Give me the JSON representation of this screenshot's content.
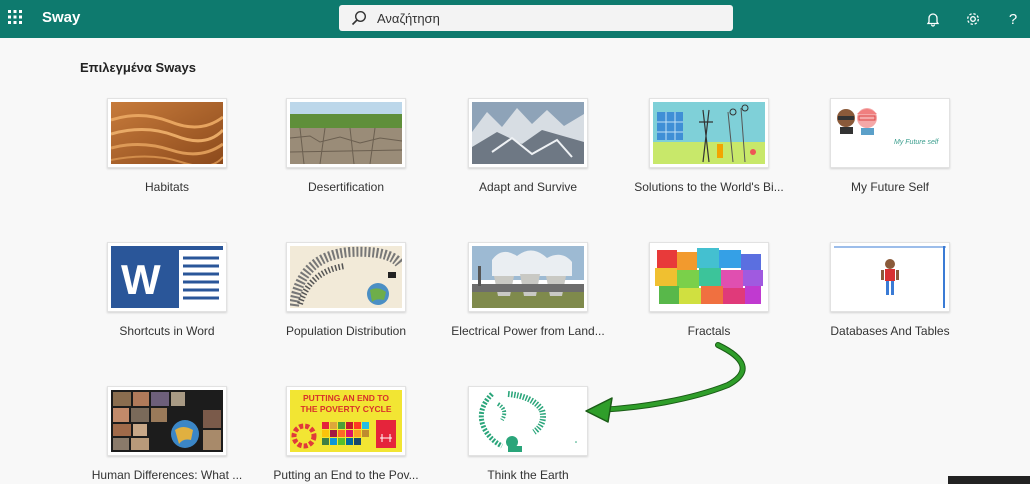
{
  "app": {
    "title": "Sway"
  },
  "search": {
    "placeholder": "Αναζήτηση"
  },
  "section": {
    "title": "Επιλεγμένα Sways"
  },
  "cards": [
    {
      "label": "Habitats"
    },
    {
      "label": "Desertification"
    },
    {
      "label": "Adapt and Survive"
    },
    {
      "label": "Solutions to the World's Bi..."
    },
    {
      "label": "My Future Self"
    },
    {
      "label": "Shortcuts in Word"
    },
    {
      "label": "Population Distribution"
    },
    {
      "label": "Electrical Power from Land..."
    },
    {
      "label": "Fractals"
    },
    {
      "label": "Databases And Tables"
    },
    {
      "label": "Human Differences: What ..."
    },
    {
      "label": "Putting an End to the Pov..."
    },
    {
      "label": "Think the Earth"
    }
  ],
  "thumb_text": {
    "future_self": "My Future self",
    "poverty_line1": "PUTTING AN END TO",
    "poverty_line2": "THE POVERTY CYCLE",
    "word_letter": "W"
  },
  "colors": {
    "header": "#0e7a6e",
    "arrow": "#2f9e2a"
  },
  "icons": {
    "launcher": "waffle-icon",
    "search": "search-icon",
    "notifications": "bell-icon",
    "settings": "gear-icon",
    "help": "help-icon"
  },
  "help_glyph": "?"
}
